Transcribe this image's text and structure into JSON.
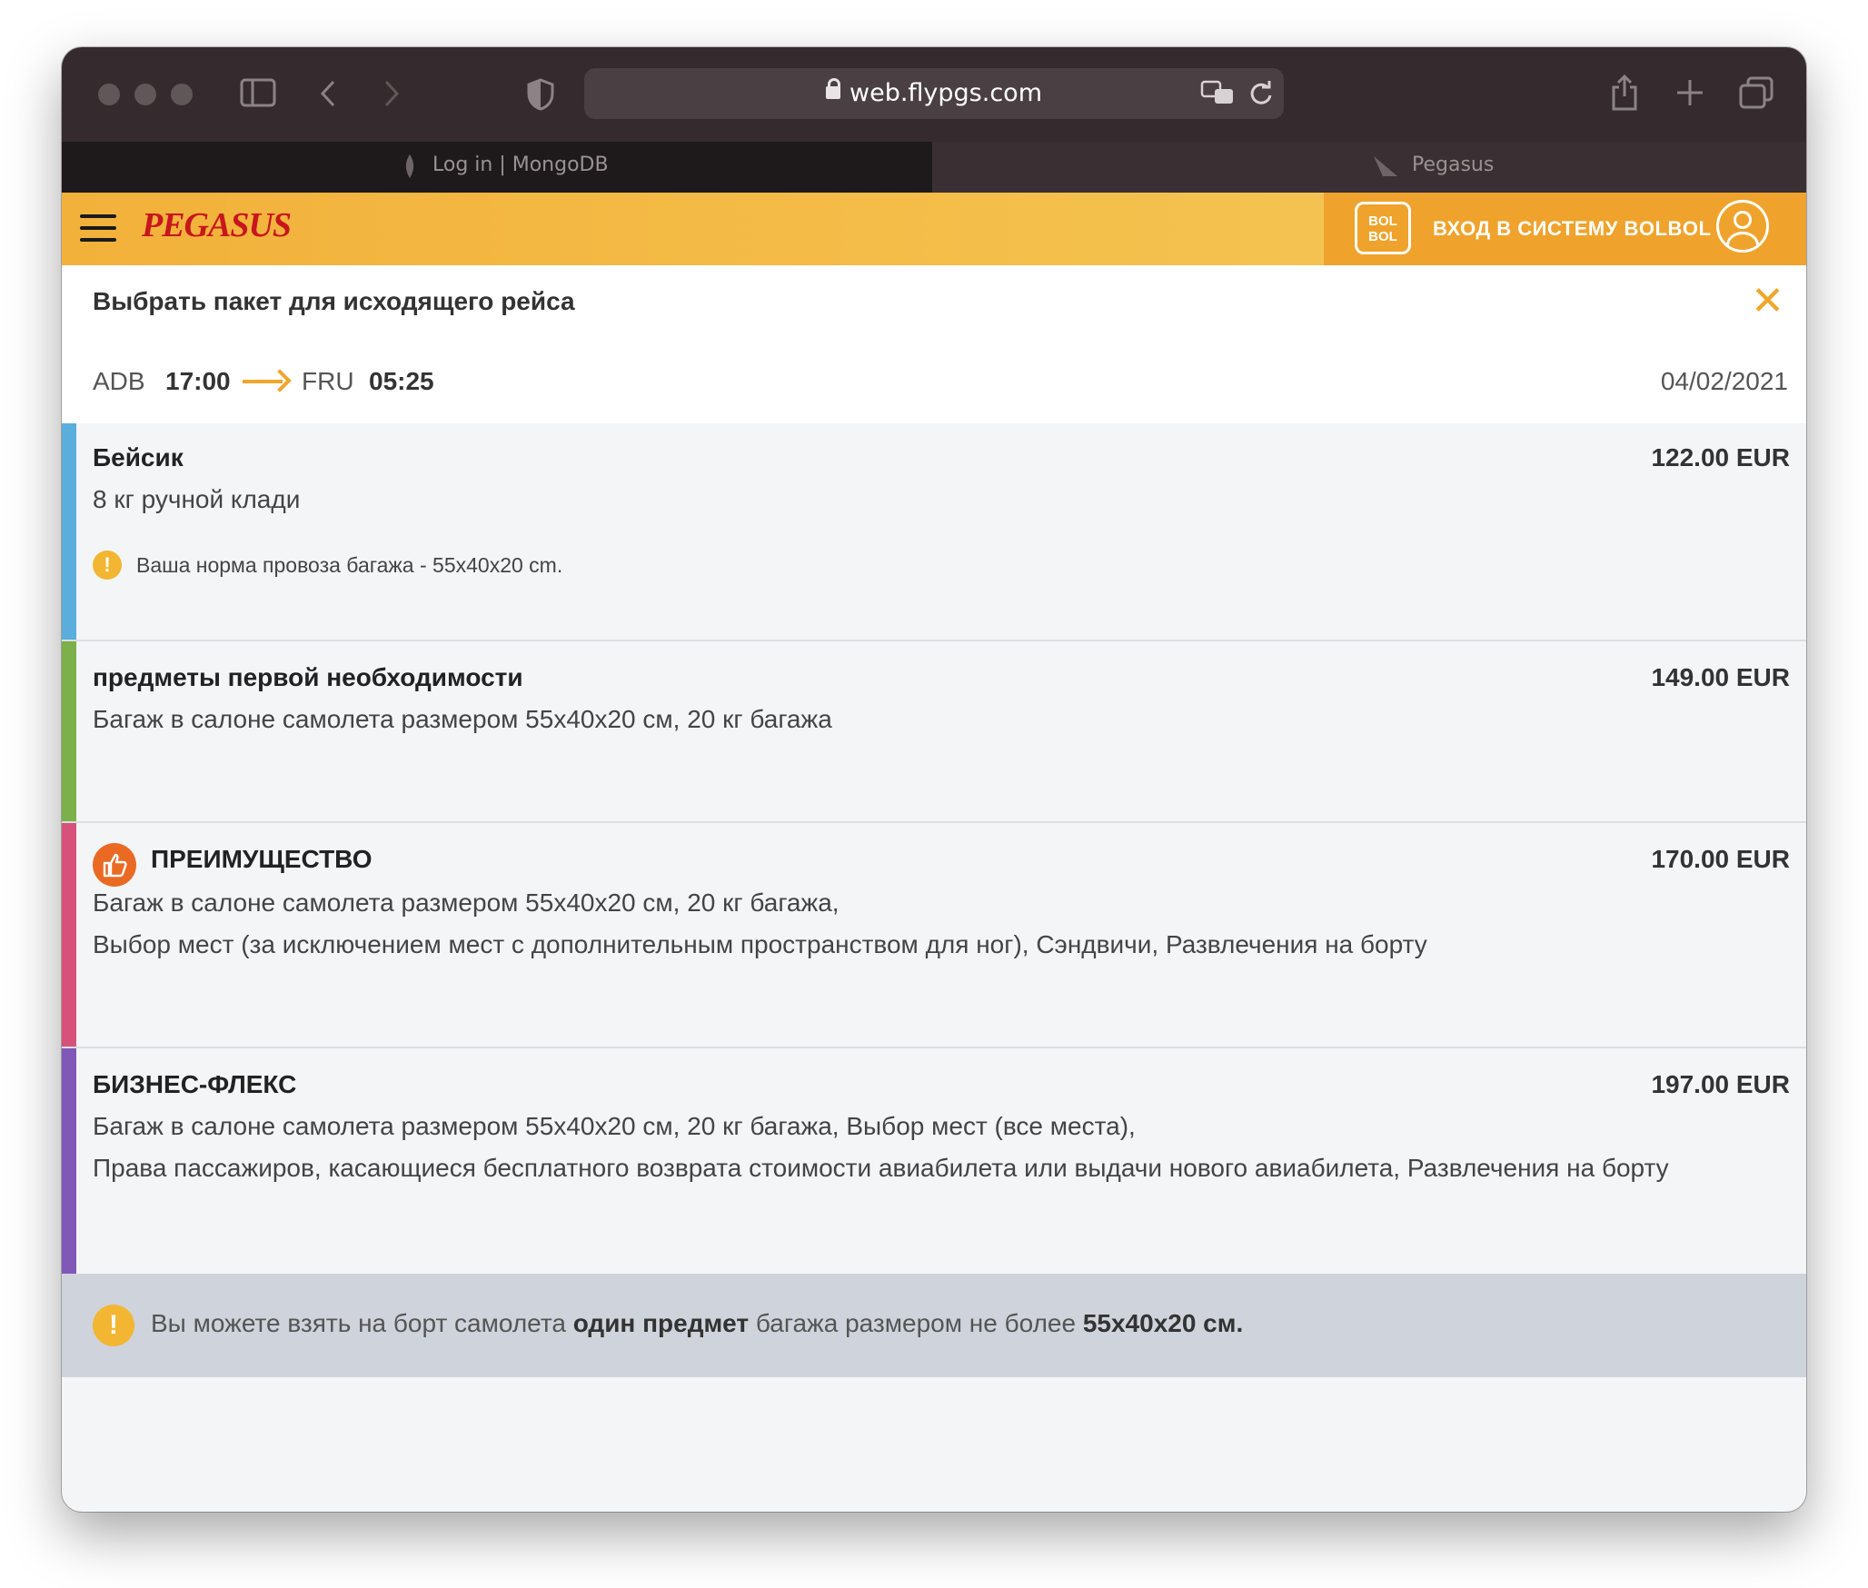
{
  "browser": {
    "url": "web.flypgs.com",
    "tabs": [
      {
        "label": "Log in | MongoDB"
      },
      {
        "label": "Pegasus"
      }
    ]
  },
  "header": {
    "brand": "PEGASUS",
    "bolbol_logo": "BOL BOL",
    "login_label": "ВХОД В СИСТЕМУ BOLBOL"
  },
  "panel": {
    "title": "Выбрать пакет для исходящего рейса",
    "close_glyph": "✕"
  },
  "flight": {
    "from_code": "ADB",
    "depart_time": "17:00",
    "to_code": "FRU",
    "arrive_time": "05:25",
    "date": "04/02/2021"
  },
  "packages": [
    {
      "name": "Бейсик",
      "price": "122.00 EUR",
      "lines": [
        "8 кг ручной клади"
      ],
      "note": "Ваша норма провоза багажа - 55x40x20 cm.",
      "color": "#5aaedb"
    },
    {
      "name": "предметы первой необходимости",
      "price": "149.00 EUR",
      "lines": [
        "Багаж в салоне самолета размером 55x40x20 см, 20 кг багажа"
      ],
      "color": "#7bb04a"
    },
    {
      "name": "ПРЕИМУЩЕСТВО",
      "price": "170.00 EUR",
      "lines": [
        "Багаж в салоне самолета размером 55x40x20 см, 20 кг багажа,",
        "Выбор мест (за исключением мест с дополнительным пространством для ног), Сэндвичи, Развлечения на борту"
      ],
      "icon": "thumbs-up-icon",
      "color": "#d6527a"
    },
    {
      "name": "БИЗНЕС-ФЛЕКС",
      "price": "197.00 EUR",
      "lines": [
        "Багаж в салоне самолета размером 55x40x20 см, 20 кг багажа, Выбор мест (все места),",
        "Права пассажиров, касающиеся бесплатного возврата стоимости авиабилета или выдачи нового авиабилета, Развлечения на борту"
      ],
      "color": "#7f58b8"
    }
  ],
  "notice": {
    "part1": "Вы можете взять на борт самолета ",
    "bold1": "один предмет",
    "part2": " багажа размером не более ",
    "bold2": "55x40x20 см."
  },
  "colors": {
    "accent": "#f0a62c",
    "brand_red": "#c8161d"
  }
}
